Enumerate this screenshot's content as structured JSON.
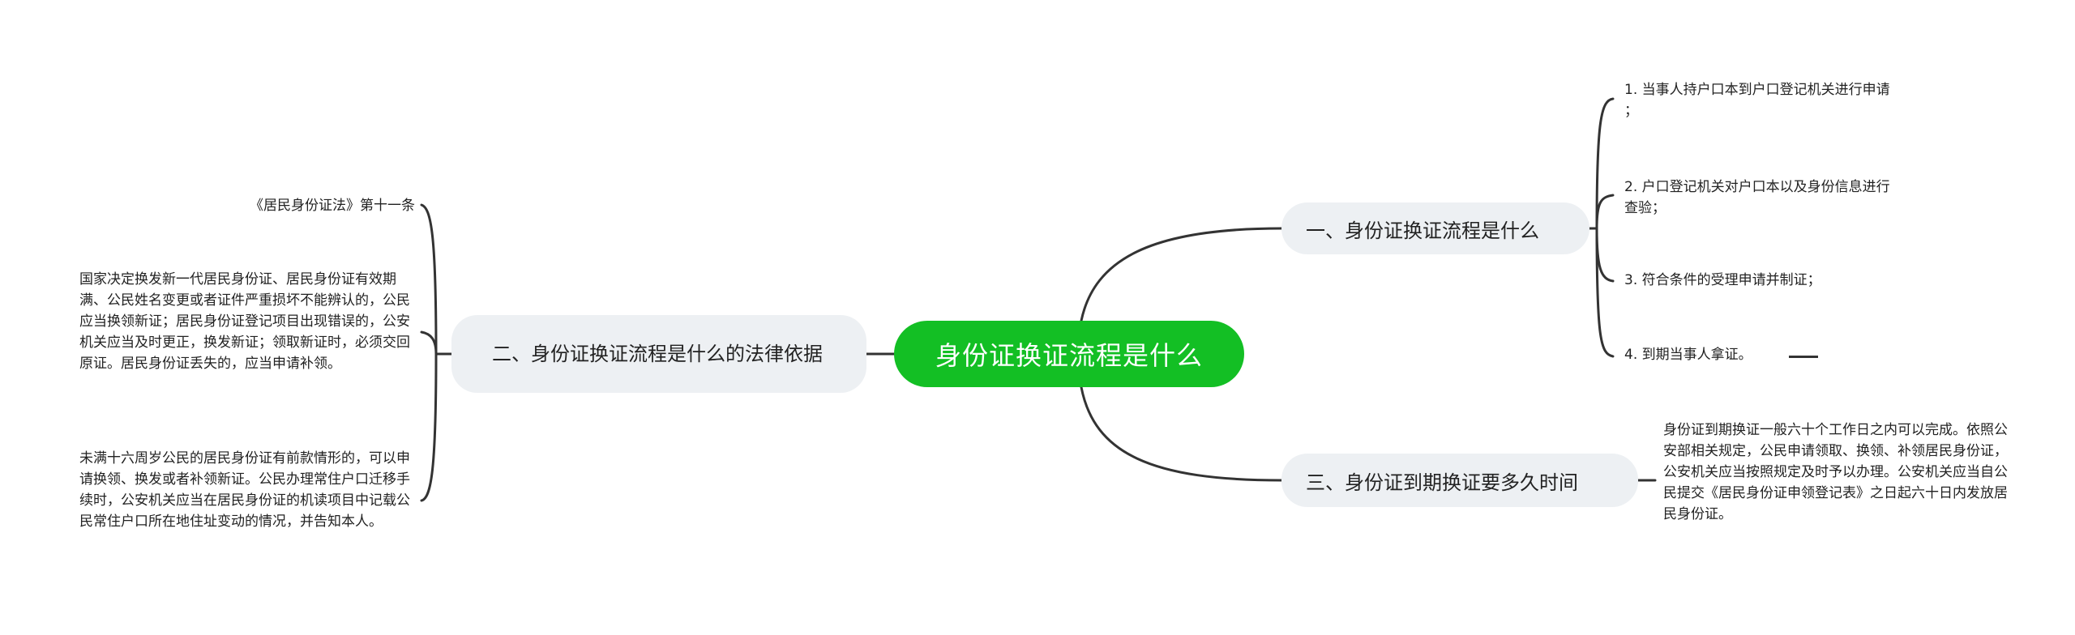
{
  "mindmap": {
    "root": {
      "label": "身份证换证流程是什么",
      "color": "#13bf24"
    },
    "topics": [
      {
        "label": "一、身份证换证流程是什么",
        "side": "right",
        "children": [
          "1. 当事人持户口本到户口登记机关进行申请\n；",
          "2. 户口登记机关对户口本以及身份信息进行\n查验；",
          "3. 符合条件的受理申请并制证；",
          "4. 到期当事人拿证。"
        ]
      },
      {
        "label": "二、身份证换证流程是什么的法律依据",
        "side": "left",
        "children": [
          "《居民身份证法》第十一条",
          "国家决定换发新一代居民身份证、居民身份证有效期满、公民姓名变更或者证件严重损坏不能辨认的，公民应当换领新证；居民身份证登记项目出现错误的，公安机关应当及时更正，换发新证；领取新证时，必须交回原证。居民身份证丢失的，应当申请补领。",
          "未满十六周岁公民的居民身份证有前款情形的，可以申请换领、换发或者补领新证。公民办理常住户口迁移手续时，公安机关应当在居民身份证的机读项目中记载公民常住户口所在地住址变动的情况，并告知本人。"
        ]
      },
      {
        "label": "三、身份证到期换证要多久时间",
        "side": "right",
        "children": [
          "身份证到期换证一般六十个工作日之内可以完成。依照公安部相关规定，公民申请领取、换领、补领居民身份证，公安机关应当按照规定及时予以办理。公安机关应当自公民提交《居民身份证申领登记表》之日起六十日内发放居民身份证。"
        ]
      }
    ],
    "colors": {
      "topic_bg": "#edf0f3",
      "line": "#333333",
      "text": "#222222"
    }
  }
}
